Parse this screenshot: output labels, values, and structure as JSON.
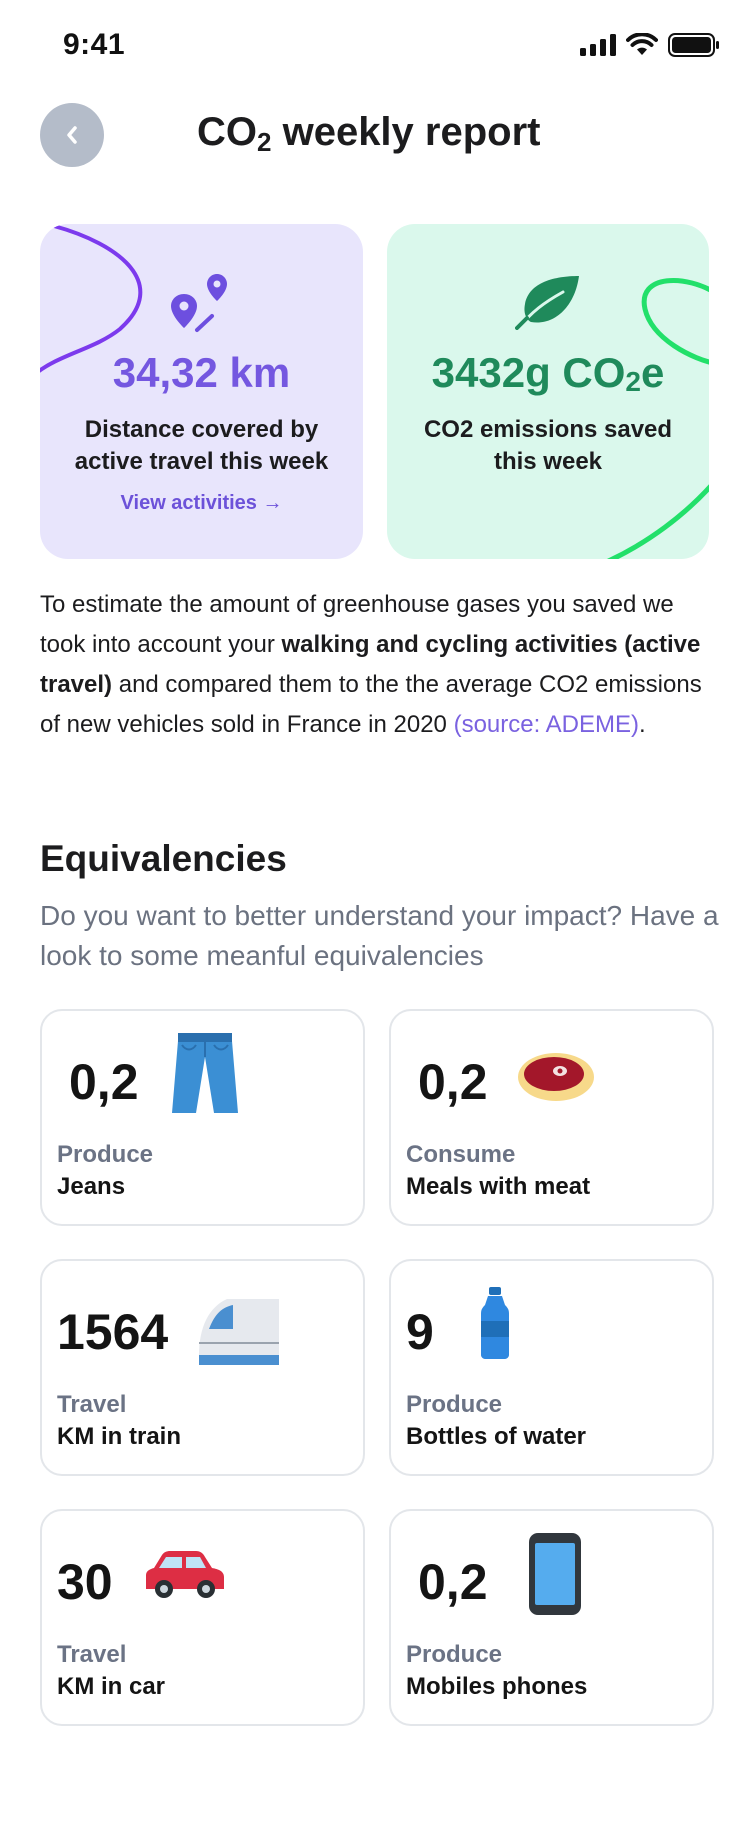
{
  "status_bar": {
    "time": "9:41"
  },
  "header": {
    "title_main": "CO",
    "title_sub": "2",
    "title_rest": " weekly report"
  },
  "distance_card": {
    "value": "34,32 km",
    "description": "Distance covered by active travel this week",
    "link": "View activities →",
    "accent_color": "#7457e0"
  },
  "co2_card": {
    "value_main": "3432g CO",
    "value_sub": "2",
    "value_rest": "e",
    "description": "CO2 emissions saved this week",
    "accent_color": "#1f8a5b"
  },
  "explanation": {
    "part1": "To estimate the amount of greenhouse gases you saved we took into account your ",
    "bold": "walking and cycling activities (active travel)",
    "part2": " and compared them to the the average CO2 emissions of new vehicles sold in France in 2020 ",
    "source": "(source: ADEME)",
    "end": "."
  },
  "equivalencies": {
    "title": "Equivalencies",
    "subtitle": "Do you want to better understand your impact? Have a look to some meanful equivalencies",
    "items": [
      {
        "value": "0,2",
        "verb": "Produce",
        "label": "Jeans",
        "icon": "jeans-icon"
      },
      {
        "value": "0,2",
        "verb": "Consume",
        "label": "Meals with meat",
        "icon": "steak-icon"
      },
      {
        "value": "1564",
        "verb": "Travel",
        "label": "KM in train",
        "icon": "train-icon"
      },
      {
        "value": "9",
        "verb": "Produce",
        "label": "Bottles of water",
        "icon": "water-bottle-icon"
      },
      {
        "value": "30",
        "verb": "Travel",
        "label": "KM in car",
        "icon": "car-icon"
      },
      {
        "value": "0,2",
        "verb": "Produce",
        "label": "Mobiles phones",
        "icon": "mobile-phone-icon"
      }
    ]
  }
}
